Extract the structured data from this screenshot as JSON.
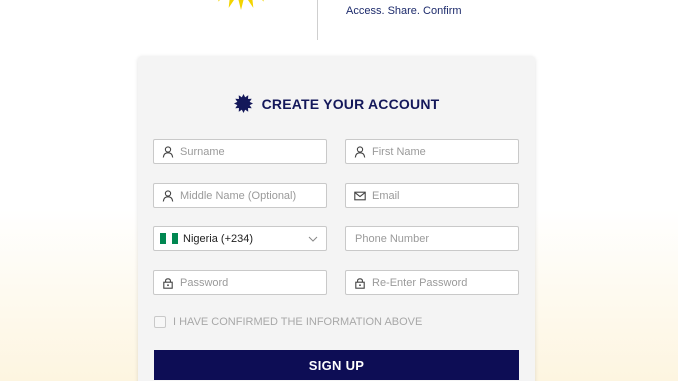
{
  "header": {
    "tagline": "Access. Share. Confirm"
  },
  "form": {
    "title": "CREATE YOUR ACCOUNT",
    "surname_placeholder": "Surname",
    "first_name_placeholder": "First Name",
    "middle_name_placeholder": "Middle Name (Optional)",
    "email_placeholder": "Email",
    "country_value": "Nigeria (+234)",
    "phone_placeholder": "Phone Number",
    "password_placeholder": "Password",
    "reenter_password_placeholder": "Re-Enter Password",
    "confirm_label": "I HAVE CONFIRMED THE INFORMATION ABOVE",
    "signup_label": "SIGN UP"
  },
  "colors": {
    "brand_navy": "#0d0d55",
    "title_navy": "#14185a",
    "logo_yellow": "#f3d400",
    "flag_green": "#008751"
  },
  "icons": [
    "logo-icon",
    "badge-icon",
    "user-icon",
    "mail-icon",
    "lock-icon",
    "chevron-down-icon",
    "nigeria-flag-icon"
  ]
}
